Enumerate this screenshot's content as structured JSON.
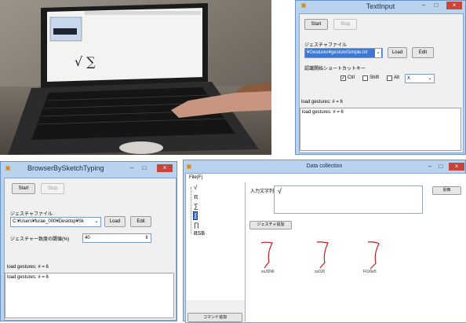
{
  "text_input_window": {
    "title": "TextInput",
    "start_label": "Start",
    "stop_label": "Stop",
    "gesture_file_label": "ジェスチャファイル",
    "gesture_file_value": "¥Gestures¥gestureSimple.txt",
    "load_label": "Load",
    "edit_label": "Edit",
    "shortcut_label": "認識開始ショートカットキー",
    "ctrl_label": "Ctrl",
    "ctrl_checked": true,
    "shift_label": "Shift",
    "shift_checked": false,
    "alt_label": "Alt",
    "alt_checked": false,
    "key_value": "X",
    "status_text": "load gestures: # = 6",
    "log_text": "load gestures: # = 6"
  },
  "browser_window": {
    "title": "BrowserBySketchTyping",
    "start_label": "Start",
    "stop_label": "Stop",
    "gesture_file_label": "ジェスチャファイル",
    "gesture_file_value": "C:¥Users¥furae_000¥Desktop¥Sk",
    "load_label": "Load",
    "edit_label": "Edit",
    "threshold_label": "ジェスチャー致度の閾値(%)",
    "threshold_value": "40",
    "status_text": "load gestures: # = 6",
    "log_text": "load gestures: # = 6"
  },
  "data_collection_window": {
    "title": "Data collection",
    "menu_file": "File(F)",
    "input_label": "入力文字列",
    "input_value": "√",
    "apply_label": "反映",
    "gesture_add_label": "ジェスチャ追加",
    "command_add_label": "コマンド追加",
    "tree_items": [
      "√",
      "π",
      "∑",
      "∫",
      "∏",
      "BSB"
    ],
    "selected_index": 3,
    "sample_labels": [
      "ssJ0N6",
      "ss0J6",
      "F0J6e5"
    ]
  }
}
